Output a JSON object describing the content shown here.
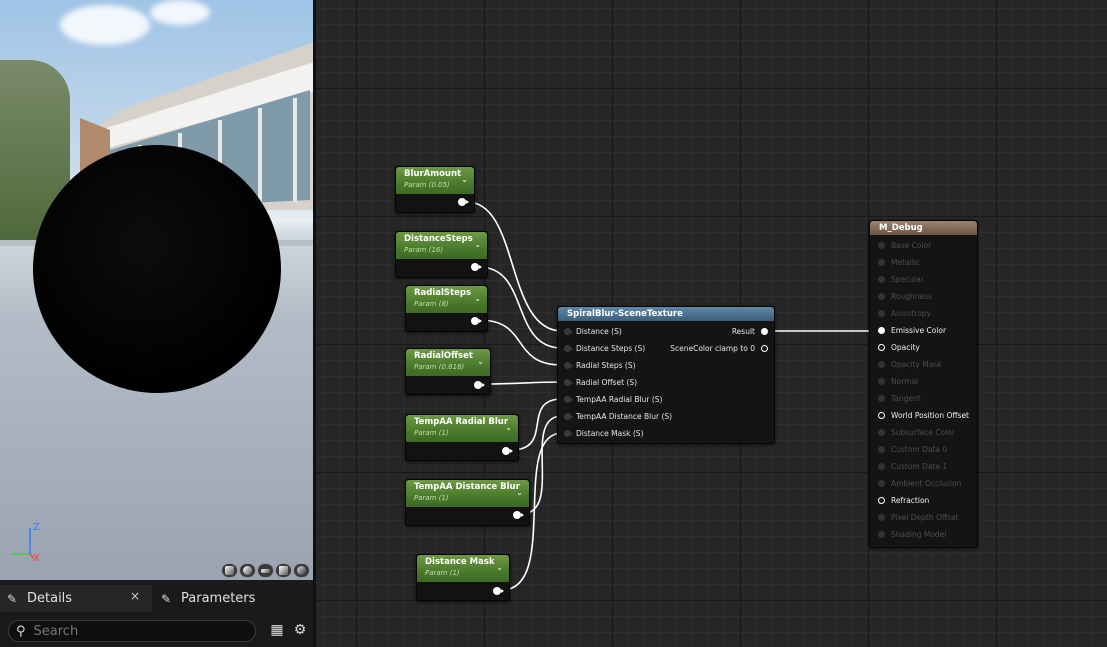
{
  "details_panel": {
    "tabs": [
      {
        "label": "Details",
        "icon": "pencil-icon"
      },
      {
        "label": "Parameters",
        "icon": "pencil-icon"
      }
    ],
    "close_glyph": "×",
    "search": {
      "placeholder": "Search",
      "value": ""
    }
  },
  "viewport": {
    "axis_labels": {
      "z": "Z",
      "x": "X"
    },
    "preview_buttons": [
      "cylinder-icon",
      "sphere-icon",
      "plane-icon",
      "cube-icon",
      "custom-mesh-icon"
    ]
  },
  "param_nodes": [
    {
      "name": "BlurAmount",
      "sub": "Param (0.05)"
    },
    {
      "name": "DistanceSteps",
      "sub": "Param (16)"
    },
    {
      "name": "RadialSteps",
      "sub": "Param (8)"
    },
    {
      "name": "RadialOffset",
      "sub": "Param (0.618)"
    },
    {
      "name": "TempAA Radial Blur",
      "sub": "Param (1)"
    },
    {
      "name": "TempAA Distance Blur",
      "sub": "Param (1)"
    },
    {
      "name": "Distance Mask",
      "sub": "Param (1)"
    }
  ],
  "function_node": {
    "title": "SpiralBlur-SceneTexture",
    "inputs": [
      "Distance (S)",
      "Distance Steps (S)",
      "Radial Steps (S)",
      "Radial Offset (S)",
      "TempAA Radial Blur (S)",
      "TempAA Distance Blur (S)",
      "Distance Mask (S)"
    ],
    "outputs": [
      "Result",
      "SceneColor clamp to 0"
    ]
  },
  "material_node": {
    "title": "M_Debug",
    "inputs": [
      {
        "label": "Base Color",
        "active": false
      },
      {
        "label": "Metallic",
        "active": false
      },
      {
        "label": "Specular",
        "active": false
      },
      {
        "label": "Roughness",
        "active": false
      },
      {
        "label": "Anisotropy",
        "active": false
      },
      {
        "label": "Emissive Color",
        "active": true,
        "connected": true
      },
      {
        "label": "Opacity",
        "active": true,
        "connected": false
      },
      {
        "label": "Opacity Mask",
        "active": false
      },
      {
        "label": "Normal",
        "active": false
      },
      {
        "label": "Tangent",
        "active": false
      },
      {
        "label": "World Position Offset",
        "active": true,
        "connected": false
      },
      {
        "label": "Subsurface Color",
        "active": false
      },
      {
        "label": "Custom Data 0",
        "active": false
      },
      {
        "label": "Custom Data 1",
        "active": false
      },
      {
        "label": "Ambient Occlusion",
        "active": false
      },
      {
        "label": "Refraction",
        "active": true,
        "connected": false
      },
      {
        "label": "Pixel Depth Offset",
        "active": false
      },
      {
        "label": "Shading Model",
        "active": false
      }
    ]
  },
  "colors": {
    "param_header": "#4a7a2c",
    "function_header": "#3b5f7e",
    "material_header": "#6b5747",
    "wire": "#ffffff"
  }
}
